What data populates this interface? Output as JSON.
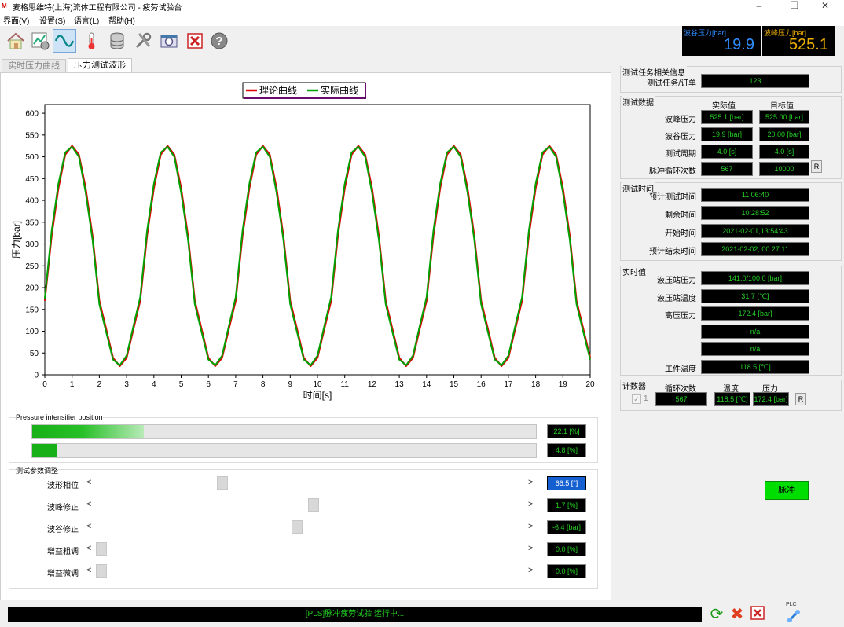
{
  "window": {
    "title": "麦格思维特(上海)流体工程有限公司 - 疲劳试验台",
    "minimize": "–",
    "restore": "❐",
    "close": "✕"
  },
  "menu": [
    "界面(V)",
    "设置(S)",
    "语言(L)",
    "帮助(H)"
  ],
  "gauges": {
    "valley": {
      "label": "波谷压力[bar]",
      "value": "19.9",
      "label_color": "#2f8cff",
      "value_color": "#2f8cff"
    },
    "peak": {
      "label": "波峰压力[bar]",
      "value": "525.1",
      "label_color": "#f0b000",
      "value_color": "#f0b000"
    }
  },
  "tabs": [
    {
      "label": "实时压力曲线",
      "active": false
    },
    {
      "label": "压力测试波形",
      "active": true
    }
  ],
  "chart_data": {
    "type": "line",
    "title": "",
    "xlabel": "时间[s]",
    "ylabel": "压力[bar]",
    "xlim": [
      0,
      20
    ],
    "ylim": [
      0,
      620
    ],
    "xticks": [
      0,
      1,
      2,
      3,
      4,
      5,
      6,
      7,
      8,
      9,
      10,
      11,
      12,
      13,
      14,
      15,
      16,
      17,
      18,
      19,
      20
    ],
    "yticks": [
      0,
      50,
      100,
      150,
      200,
      250,
      300,
      350,
      400,
      450,
      500,
      550,
      600
    ],
    "grid": true,
    "legend_position": "top",
    "series": [
      {
        "name": "理论曲线",
        "color": "#e00000",
        "x": [
          0,
          0.25,
          0.5,
          0.75,
          1,
          1.25,
          1.5,
          1.75,
          2,
          2.25,
          2.5,
          2.75,
          3,
          3.25,
          3.5,
          3.75,
          4,
          4.25,
          4.5,
          4.75,
          5,
          5.25,
          5.5,
          5.75,
          6,
          6.25,
          6.5,
          6.75,
          7,
          7.25,
          7.5,
          7.75,
          8,
          8.25,
          8.5,
          8.75,
          9,
          9.25,
          9.5,
          9.75,
          10,
          10.25,
          10.5,
          10.75,
          11,
          11.25,
          11.5,
          11.75,
          12,
          12.25,
          12.5,
          12.75,
          13,
          13.25,
          13.5,
          13.75,
          14,
          14.25,
          14.5,
          14.75,
          15,
          15.25,
          15.5,
          15.75,
          16,
          16.25,
          16.5,
          16.75,
          17,
          17.25,
          17.5,
          17.75,
          18,
          18.25,
          18.5,
          18.75,
          19,
          19.25,
          19.5,
          19.75,
          20
        ],
        "y": [
          170,
          319,
          428,
          505,
          525,
          505,
          428,
          319,
          170,
          105,
          39,
          20,
          39,
          105,
          170,
          319,
          428,
          505,
          525,
          505,
          428,
          319,
          170,
          105,
          39,
          20,
          39,
          105,
          170,
          319,
          428,
          505,
          525,
          505,
          428,
          319,
          170,
          105,
          39,
          20,
          39,
          105,
          170,
          319,
          428,
          505,
          525,
          505,
          428,
          319,
          170,
          105,
          39,
          20,
          39,
          105,
          170,
          319,
          428,
          505,
          525,
          505,
          428,
          319,
          170,
          105,
          39,
          20,
          39,
          105,
          170,
          319,
          428,
          505,
          525,
          505,
          428,
          319,
          170,
          105,
          39
        ]
      },
      {
        "name": "实际曲线",
        "color": "#00a000",
        "x": [
          0,
          0.25,
          0.5,
          0.75,
          1,
          1.25,
          1.5,
          1.75,
          2,
          2.25,
          2.5,
          2.75,
          3,
          3.25,
          3.5,
          3.75,
          4,
          4.25,
          4.5,
          4.75,
          5,
          5.25,
          5.5,
          5.75,
          6,
          6.25,
          6.5,
          6.75,
          7,
          7.25,
          7.5,
          7.75,
          8,
          8.25,
          8.5,
          8.75,
          9,
          9.25,
          9.5,
          9.75,
          10,
          10.25,
          10.5,
          10.75,
          11,
          11.25,
          11.5,
          11.75,
          12,
          12.25,
          12.5,
          12.75,
          13,
          13.25,
          13.5,
          13.75,
          14,
          14.25,
          14.5,
          14.75,
          15,
          15.25,
          15.5,
          15.75,
          16,
          16.25,
          16.5,
          16.75,
          17,
          17.25,
          17.5,
          17.75,
          18,
          18.25,
          18.5,
          18.75,
          19,
          19.25,
          19.5,
          19.75,
          20
        ],
        "y": [
          175,
          330,
          438,
          510,
          523,
          500,
          418,
          310,
          162,
          98,
          35,
          22,
          44,
          112,
          178,
          330,
          438,
          510,
          523,
          500,
          418,
          310,
          162,
          98,
          35,
          22,
          44,
          112,
          178,
          330,
          438,
          510,
          523,
          500,
          418,
          310,
          162,
          98,
          35,
          22,
          44,
          112,
          178,
          330,
          438,
          510,
          523,
          500,
          418,
          310,
          162,
          98,
          35,
          22,
          44,
          112,
          178,
          330,
          438,
          510,
          523,
          500,
          418,
          310,
          162,
          98,
          35,
          22,
          44,
          112,
          178,
          330,
          438,
          510,
          523,
          500,
          418,
          310,
          162,
          98,
          35
        ]
      }
    ]
  },
  "intensifier": {
    "title": "Pressure intensifier position",
    "bars": [
      {
        "value": "22.1 [%]",
        "fraction": 0.221,
        "gradient": true
      },
      {
        "value": "4.8 [%]",
        "fraction": 0.048,
        "gradient": false
      }
    ]
  },
  "tuning": {
    "title": "测试参数调整",
    "left_arrow": "<",
    "right_arrow": ">",
    "rows": [
      {
        "label": "波形相位",
        "value": "66.5 [°]",
        "position": 0.29,
        "selected": true
      },
      {
        "label": "波峰修正",
        "value": "1.7 [%]",
        "position": 0.51,
        "selected": false
      },
      {
        "label": "波谷修正",
        "value": "-6.4 [bar]",
        "position": 0.47,
        "selected": false
      },
      {
        "label": "增益粗调",
        "value": "0.0 [%]",
        "position": 0.0,
        "selected": false
      },
      {
        "label": "增益微调",
        "value": "0.0 [%]",
        "position": 0.0,
        "selected": false
      }
    ]
  },
  "task_info": {
    "title": "测试任务相关信息",
    "order_label": "测试任务/订单",
    "order_value": "123"
  },
  "test_data": {
    "title": "测试数据",
    "col_actual": "实际值",
    "col_target": "目标值",
    "rows": [
      {
        "label": "波峰压力",
        "actual": "525.1 [bar]",
        "target": "525.00 [bar]"
      },
      {
        "label": "波谷压力",
        "actual": "19.9 [bar]",
        "target": "20.00 [bar]"
      },
      {
        "label": "测试周期",
        "actual": "4.0 [s]",
        "target": "4.0 [s]"
      },
      {
        "label": "脉冲循环次数",
        "actual": "567",
        "target": "10000"
      }
    ],
    "reset_label": "R"
  },
  "test_time": {
    "title": "测试时间",
    "rows": [
      {
        "label": "预计测试时间",
        "value": "11:06:40"
      },
      {
        "label": "剩余时间",
        "value": "10:28:52"
      },
      {
        "label": "开始时间",
        "value": "2021-02-01,13:54:43"
      },
      {
        "label": "预计结束时间",
        "value": "2021-02-02, 00:27:11"
      }
    ]
  },
  "realtime": {
    "title": "实时值",
    "rows": [
      {
        "label": "液压站压力",
        "value": "141.0/100.0 [bar]"
      },
      {
        "label": "液压站温度",
        "value": "31.7 [℃]"
      },
      {
        "label": "高压压力",
        "value": "172.4 [bar]"
      },
      {
        "label": "",
        "value": "n/a"
      },
      {
        "label": "",
        "value": "n/a"
      },
      {
        "label": "工件温度",
        "value": "118.5 [℃]"
      }
    ]
  },
  "counter": {
    "title": "计数器",
    "col_cycles": "循环次数",
    "col_temp": "温度",
    "col_pressure": "压力",
    "checkbox_label": "1",
    "cycles": "567",
    "temp": "118.5 [℃]",
    "pressure": "172.4 [bar]",
    "reset_label": "R"
  },
  "pulse_button": "脉冲",
  "status": {
    "text": "[PLS]脉冲疲劳试验 运行中...",
    "plc_label": "PLC"
  }
}
